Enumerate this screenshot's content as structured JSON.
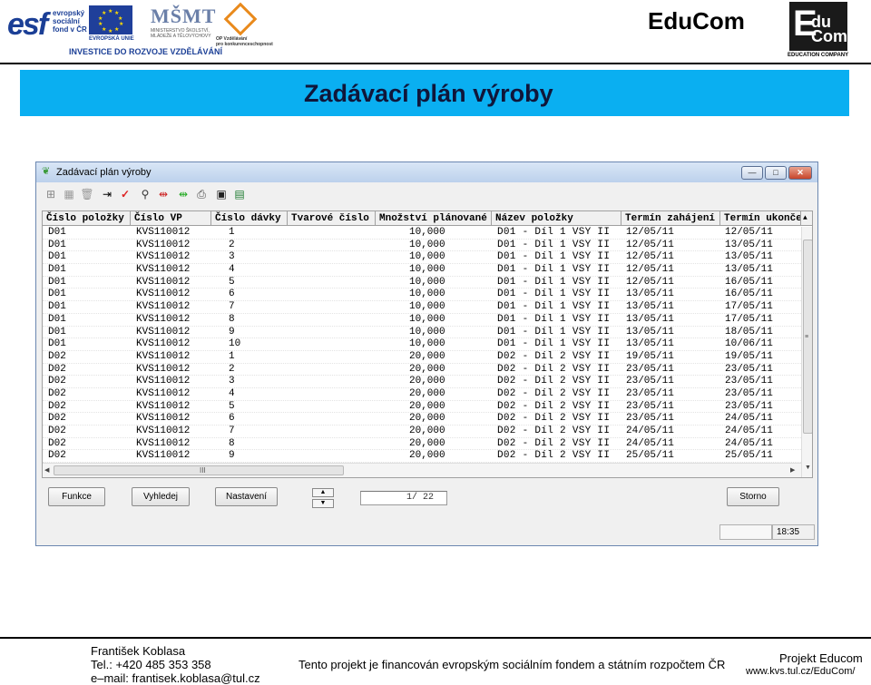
{
  "header": {
    "esf_logo": {
      "big": "esf",
      "lines": [
        "evropský",
        "sociální",
        "fond v ČR"
      ]
    },
    "eu_logo": {
      "caption": "EVROPSKÁ UNIE"
    },
    "msmt_logo": {
      "mark": "MŠMT",
      "lines": [
        "MINISTERSTVO ŠKOLSTVÍ,",
        "MLÁDEŽE A TĚLOVÝCHOVY"
      ]
    },
    "op_logo": {
      "lines": [
        "OP Vzdělávání",
        "pro konkurenceschopnost"
      ]
    },
    "tagline": "INVESTICE DO ROZVOJE VZDĚLÁVÁNÍ",
    "brand": "EduCom",
    "brand_logo": {
      "e": "E",
      "du": "du",
      "com": "Com",
      "caption": "EDUCATION COMPANY"
    }
  },
  "banner": {
    "title": "Zadávací plán výroby"
  },
  "window": {
    "title": "Zadávací plán výroby",
    "controls": {
      "minimize": "—",
      "maximize": "□",
      "close": "✕"
    },
    "toolbar": [
      "add-row-icon",
      "grid-icon",
      "delete-icon",
      "insert-icon",
      "check-icon",
      "search-icon",
      "split-red-icon",
      "split-green-icon",
      "print-icon",
      "window-icon",
      "excel-icon"
    ],
    "columns": [
      "Číslo položky",
      "Číslo VP",
      "Číslo dávky",
      "Tvarové číslo",
      "Množství plánované",
      "Název položky",
      "Termín zahájení",
      "Termín ukonče"
    ],
    "rows": [
      {
        "item": "D01",
        "vp": "KVS110012",
        "batch": "1",
        "shape": "",
        "qty": "10,000",
        "name": "D01 - Díl 1 VSY II",
        "start": "12/05/11",
        "end": "12/05/11"
      },
      {
        "item": "D01",
        "vp": "KVS110012",
        "batch": "2",
        "shape": "",
        "qty": "10,000",
        "name": "D01 - Díl 1 VSY II",
        "start": "12/05/11",
        "end": "13/05/11"
      },
      {
        "item": "D01",
        "vp": "KVS110012",
        "batch": "3",
        "shape": "",
        "qty": "10,000",
        "name": "D01 - Díl 1 VSY II",
        "start": "12/05/11",
        "end": "13/05/11"
      },
      {
        "item": "D01",
        "vp": "KVS110012",
        "batch": "4",
        "shape": "",
        "qty": "10,000",
        "name": "D01 - Díl 1 VSY II",
        "start": "12/05/11",
        "end": "13/05/11"
      },
      {
        "item": "D01",
        "vp": "KVS110012",
        "batch": "5",
        "shape": "",
        "qty": "10,000",
        "name": "D01 - Díl 1 VSY II",
        "start": "12/05/11",
        "end": "16/05/11"
      },
      {
        "item": "D01",
        "vp": "KVS110012",
        "batch": "6",
        "shape": "",
        "qty": "10,000",
        "name": "D01 - Díl 1 VSY II",
        "start": "13/05/11",
        "end": "16/05/11"
      },
      {
        "item": "D01",
        "vp": "KVS110012",
        "batch": "7",
        "shape": "",
        "qty": "10,000",
        "name": "D01 - Díl 1 VSY II",
        "start": "13/05/11",
        "end": "17/05/11"
      },
      {
        "item": "D01",
        "vp": "KVS110012",
        "batch": "8",
        "shape": "",
        "qty": "10,000",
        "name": "D01 - Díl 1 VSY II",
        "start": "13/05/11",
        "end": "17/05/11"
      },
      {
        "item": "D01",
        "vp": "KVS110012",
        "batch": "9",
        "shape": "",
        "qty": "10,000",
        "name": "D01 - Díl 1 VSY II",
        "start": "13/05/11",
        "end": "18/05/11"
      },
      {
        "item": "D01",
        "vp": "KVS110012",
        "batch": "10",
        "shape": "",
        "qty": "10,000",
        "name": "D01 - Díl 1 VSY II",
        "start": "13/05/11",
        "end": "10/06/11"
      },
      {
        "item": "D02",
        "vp": "KVS110012",
        "batch": "1",
        "shape": "",
        "qty": "20,000",
        "name": "D02 - Díl 2 VSY II",
        "start": "19/05/11",
        "end": "19/05/11"
      },
      {
        "item": "D02",
        "vp": "KVS110012",
        "batch": "2",
        "shape": "",
        "qty": "20,000",
        "name": "D02 - Díl 2 VSY II",
        "start": "23/05/11",
        "end": "23/05/11"
      },
      {
        "item": "D02",
        "vp": "KVS110012",
        "batch": "3",
        "shape": "",
        "qty": "20,000",
        "name": "D02 - Díl 2 VSY II",
        "start": "23/05/11",
        "end": "23/05/11"
      },
      {
        "item": "D02",
        "vp": "KVS110012",
        "batch": "4",
        "shape": "",
        "qty": "20,000",
        "name": "D02 - Díl 2 VSY II",
        "start": "23/05/11",
        "end": "23/05/11"
      },
      {
        "item": "D02",
        "vp": "KVS110012",
        "batch": "5",
        "shape": "",
        "qty": "20,000",
        "name": "D02 - Díl 2 VSY II",
        "start": "23/05/11",
        "end": "23/05/11"
      },
      {
        "item": "D02",
        "vp": "KVS110012",
        "batch": "6",
        "shape": "",
        "qty": "20,000",
        "name": "D02 - Díl 2 VSY II",
        "start": "23/05/11",
        "end": "24/05/11"
      },
      {
        "item": "D02",
        "vp": "KVS110012",
        "batch": "7",
        "shape": "",
        "qty": "20,000",
        "name": "D02 - Díl 2 VSY II",
        "start": "24/05/11",
        "end": "24/05/11"
      },
      {
        "item": "D02",
        "vp": "KVS110012",
        "batch": "8",
        "shape": "",
        "qty": "20,000",
        "name": "D02 - Díl 2 VSY II",
        "start": "24/05/11",
        "end": "24/05/11"
      },
      {
        "item": "D02",
        "vp": "KVS110012",
        "batch": "9",
        "shape": "",
        "qty": "20,000",
        "name": "D02 - Díl 2 VSY II",
        "start": "25/05/11",
        "end": "25/05/11"
      }
    ],
    "scroll_grip": "III",
    "buttons": {
      "funkce": "Funkce",
      "vyhledej": "Vyhledej",
      "nastaveni": "Nastavení",
      "storno": "Storno"
    },
    "record_counter": "1/   22",
    "status_time": "18:35"
  },
  "footer": {
    "author": "František Koblasa",
    "phone": "Tel.: +420 485 353 358",
    "email": "e–mail: frantisek.koblasa@tul.cz",
    "funding": "Tento projekt je financován evropským sociálním fondem a státním rozpočtem ČR",
    "project": "Projekt Educom",
    "url": "www.kvs.tul.cz/EduCom/"
  },
  "colors": {
    "banner": "#0aaff1",
    "titlebar": "#c8d9ef",
    "close": "#c7442a"
  }
}
